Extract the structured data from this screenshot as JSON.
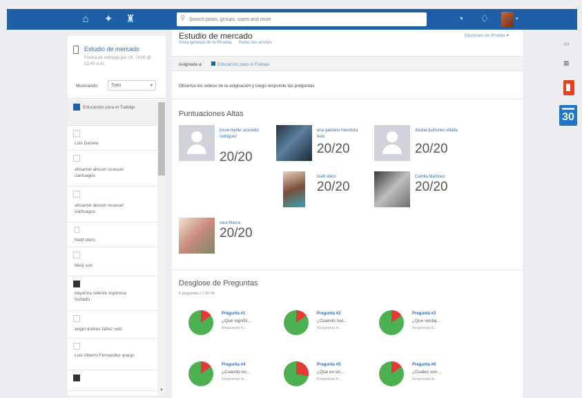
{
  "search": {
    "placeholder": "Search posts, groups, users and more"
  },
  "left": {
    "assignment_title": "Estudio de mercado",
    "due": "Fecha de entrega jun 19, 2016 @ 11:45 p.m.",
    "filter_label": "Mostrando:",
    "filter_value": "Todo",
    "items": [
      {
        "name": "Educación para el Trabajo",
        "marker": "group"
      },
      {
        "name": "Luis Dariela",
        "marker": "empty"
      },
      {
        "name": "ahsamel aliscen ocasuel ciarfuagos",
        "marker": "empty"
      },
      {
        "name": "ahsamel aliscen ocasuel ciarfuagos",
        "marker": "empty"
      },
      {
        "name": "lisett otero",
        "marker": "small"
      },
      {
        "name": "Meiji sun",
        "marker": "empty"
      },
      {
        "name": "dayanna celeste espinosa hurtado",
        "marker": "img"
      },
      {
        "name": "angel andres fañez vetz",
        "marker": "empty"
      },
      {
        "name": "Luis Alberto Fernandez araujo",
        "marker": "empty"
      },
      {
        "name": "",
        "marker": "img"
      }
    ]
  },
  "main": {
    "title": "Estudio de mercado",
    "subnav": [
      "Vista general de la Prueba",
      "Todos los envíos"
    ],
    "options": "Opciones de Prueba",
    "assigned_label": "Asignada a:",
    "assigned_group": "Educación para el Trabajo",
    "instructions": "Observa los videos de la asignación y luego responde las preguntas",
    "high_scores_title": "Puntuaciones Altas",
    "scores": [
      {
        "name": "josue leyder acevedo rodriguez",
        "value": "20/20",
        "photo": "default"
      },
      {
        "name": "ana gabriela mendoza leon",
        "value": "20/20",
        "photo": "photo-a"
      },
      {
        "name": "Ariana quiñones villalta",
        "value": "20/20",
        "photo": "default"
      },
      {
        "name": "lisett otero",
        "value": "20/20",
        "photo": "photo-b"
      },
      {
        "name": "Camila Martinez",
        "value": "20/20",
        "photo": "photo-c"
      },
      {
        "name": "sara Marca",
        "value": "20/20",
        "photo": "photo-d"
      }
    ],
    "breakdown_title": "Desglose de Preguntas",
    "breakdown_sub": "6 preguntas | 1:00:00",
    "questions": [
      {
        "label": "Pregunta #1",
        "text": "¿Que signific...",
        "resp": "Respuesta lo...",
        "correct_fraction": 0.85
      },
      {
        "label": "Pregunta #2",
        "text": "¿Cuando hac...",
        "resp": "Respuesta lo...",
        "correct_fraction": 0.85
      },
      {
        "label": "Pregunta #3",
        "text": "¿Que ventaj...",
        "resp": "Respuesta lo...",
        "correct_fraction": 0.85
      },
      {
        "label": "Pregunta #4",
        "text": "¿Cuando no...",
        "resp": "Respuesta lo...",
        "correct_fraction": 0.85
      },
      {
        "label": "Pregunta #5",
        "text": "¿Que es un ...",
        "resp": "Respuesta lo...",
        "correct_fraction": 0.72
      },
      {
        "label": "Pregunta #6",
        "text": "¿Cuales son ...",
        "resp": "Respuesta le...",
        "correct_fraction": 0.85
      }
    ]
  },
  "rightrail": {
    "calendar_day": "30"
  },
  "colors": {
    "brand": "#1f5fa8",
    "correct": "#4caf50",
    "incorrect": "#e53935",
    "office": "#e2431e"
  }
}
